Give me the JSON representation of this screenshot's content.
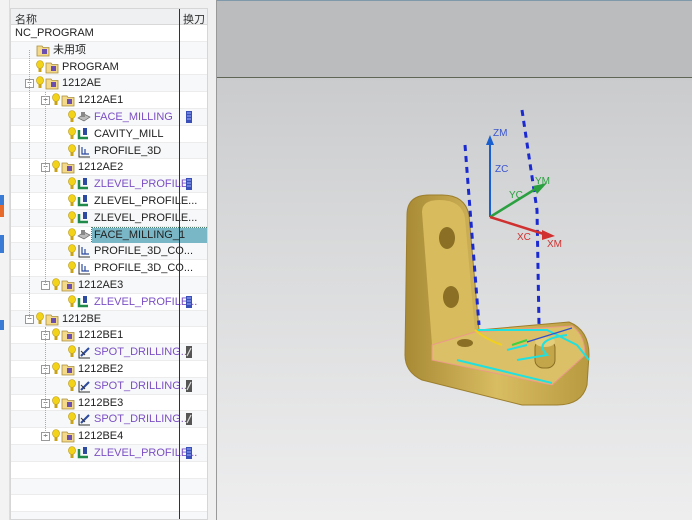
{
  "navigator": {
    "columns": {
      "name": "名称",
      "tool_change": "换刀"
    },
    "rows": [
      {
        "label": "NC_PROGRAM",
        "level": 0,
        "type": "root"
      },
      {
        "label": "未用项",
        "level": 1,
        "type": "unused"
      },
      {
        "label": "PROGRAM",
        "level": 1,
        "type": "program"
      },
      {
        "label": "1212AE",
        "level": 1,
        "type": "program",
        "expanded": true
      },
      {
        "label": "1212AE1",
        "level": 2,
        "type": "program",
        "expanded": true
      },
      {
        "label": "FACE_MILLING",
        "level": 3,
        "type": "face-mill",
        "purple": true,
        "tool": "mill-tool"
      },
      {
        "label": "CAVITY_MILL",
        "level": 3,
        "type": "cavity-mill"
      },
      {
        "label": "PROFILE_3D",
        "level": 3,
        "type": "profile"
      },
      {
        "label": "1212AE2",
        "level": 2,
        "type": "program",
        "expanded": true
      },
      {
        "label": "ZLEVEL_PROFILE",
        "level": 3,
        "type": "cavity-mill",
        "purple": true,
        "tool": "mill-tool"
      },
      {
        "label": "ZLEVEL_PROFILE...",
        "level": 3,
        "type": "cavity-mill"
      },
      {
        "label": "ZLEVEL_PROFILE...",
        "level": 3,
        "type": "cavity-mill"
      },
      {
        "label": "FACE_MILLING_1",
        "level": 3,
        "type": "face-mill",
        "selected": true
      },
      {
        "label": "PROFILE_3D_CO...",
        "level": 3,
        "type": "profile"
      },
      {
        "label": "PROFILE_3D_CO...",
        "level": 3,
        "type": "profile"
      },
      {
        "label": "1212AE3",
        "level": 2,
        "type": "program",
        "expanded": true
      },
      {
        "label": "ZLEVEL_PROFILE...",
        "level": 3,
        "type": "cavity-mill",
        "purple": true,
        "tool": "mill-tool"
      },
      {
        "label": "1212BE",
        "level": 1,
        "type": "program",
        "expanded": true
      },
      {
        "label": "1212BE1",
        "level": 2,
        "type": "program",
        "expanded": true
      },
      {
        "label": "SPOT_DRILLING...",
        "level": 3,
        "type": "drill",
        "purple": true,
        "tool": "drill-tool"
      },
      {
        "label": "1212BE2",
        "level": 2,
        "type": "program",
        "expanded": true
      },
      {
        "label": "SPOT_DRILLING...",
        "level": 3,
        "type": "drill",
        "purple": true,
        "tool": "drill-tool"
      },
      {
        "label": "1212BE3",
        "level": 2,
        "type": "program",
        "expanded": true
      },
      {
        "label": "SPOT_DRILLING...",
        "level": 3,
        "type": "drill",
        "purple": true,
        "tool": "drill-tool"
      },
      {
        "label": "1212BE4",
        "level": 2,
        "type": "program",
        "expanded": true
      },
      {
        "label": "ZLEVEL_PROFILE...",
        "level": 3,
        "type": "cavity-mill",
        "purple": true,
        "tool": "mill-tool"
      }
    ]
  },
  "viewport": {
    "axes": {
      "zm": "ZM",
      "zc": "ZC",
      "ym": "YM",
      "yc": "YC",
      "xc": "XC",
      "xm": "XM"
    }
  },
  "colors": {
    "selected": "#7ab7c6",
    "purple_text": "#7b4fc4",
    "part": "#c9a94a",
    "toolpath": "#1a2ad0"
  }
}
